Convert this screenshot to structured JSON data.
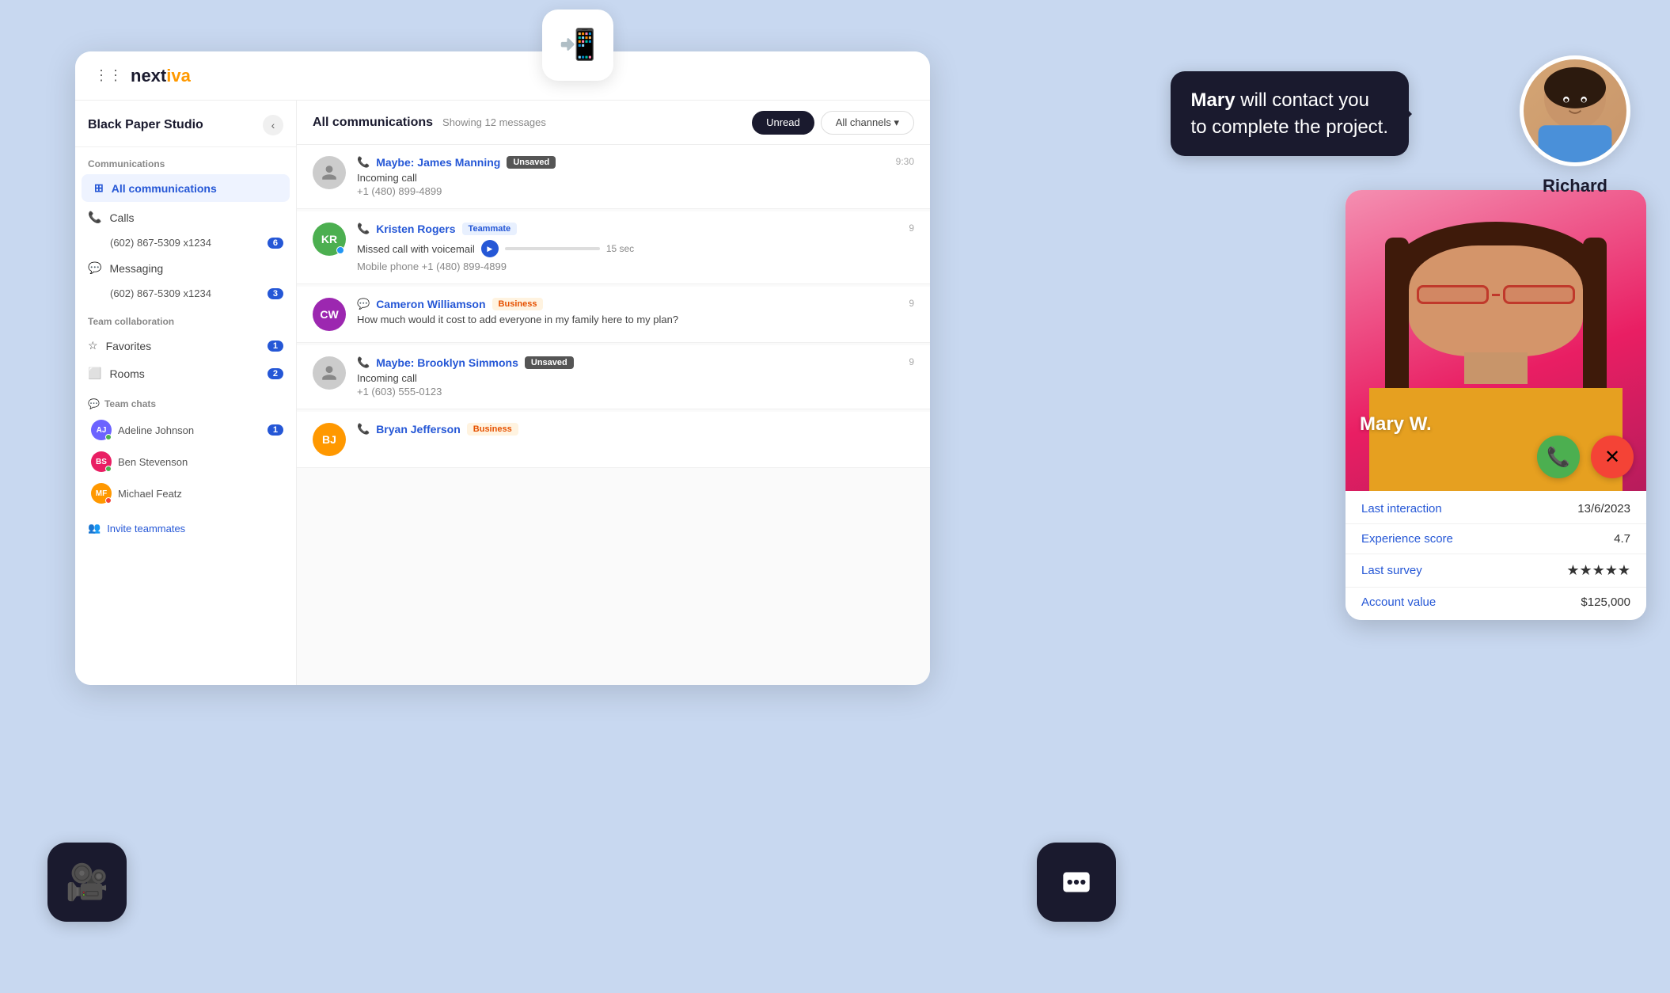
{
  "app": {
    "logo_next": "next",
    "logo_tiva": "iva",
    "workspace_name": "Black Paper Studio"
  },
  "sidebar": {
    "sections": {
      "communications": "Communications",
      "team_collaboration": "Team collaboration",
      "team_chats": "Team chats"
    },
    "nav_items": [
      {
        "id": "all-communications",
        "label": "All communications",
        "icon": "⊞",
        "active": true
      },
      {
        "id": "calls",
        "label": "Calls",
        "icon": "📞"
      },
      {
        "id": "calls-number",
        "label": "(602) 867-5309 x1234",
        "badge": "6"
      },
      {
        "id": "messaging",
        "label": "Messaging",
        "icon": "💬"
      },
      {
        "id": "messaging-number",
        "label": "(602) 867-5309 x1234",
        "badge": "3"
      }
    ],
    "team_collab": [
      {
        "id": "favorites",
        "label": "Favorites",
        "icon": "☆",
        "badge": "1"
      },
      {
        "id": "rooms",
        "label": "Rooms",
        "icon": "⬜",
        "badge": "2"
      }
    ],
    "team_chat_users": [
      {
        "id": "adeline",
        "label": "Adeline Johnson",
        "initials": "AJ",
        "color": "#6c63ff",
        "dot_color": "#4caf50",
        "badge": "1"
      },
      {
        "id": "ben",
        "label": "Ben Stevenson",
        "initials": "BS",
        "color": "#e91e63",
        "dot_color": "#4caf50"
      },
      {
        "id": "michael",
        "label": "Michael Featz",
        "initials": "MF",
        "color": "#ff9800",
        "dot_color": "#f44336"
      }
    ],
    "invite_label": "Invite teammates"
  },
  "communications": {
    "title": "All communications",
    "subtitle": "Showing 12 messages",
    "filters": {
      "unread": "Unread",
      "all_channels": "All channels ▾"
    },
    "messages": [
      {
        "id": "james-manning",
        "name": "Maybe: James Manning",
        "tag": "Unsaved",
        "tag_type": "unsaved",
        "line1": "Incoming call",
        "line2": "+1 (480) 899-4899",
        "time": "9:30",
        "avatar_initials": "",
        "avatar_color": "gray",
        "icon": "phone"
      },
      {
        "id": "kristen-rogers",
        "name": "Kristen Rogers",
        "tag": "Teammate",
        "tag_type": "teammate",
        "line1": "Missed call with voicemail",
        "line2": "Mobile phone +1 (480) 899-4899",
        "time": "9",
        "avatar_initials": "KR",
        "avatar_color": "#4caf50",
        "has_voicemail": true,
        "voicemail_duration": "15 sec",
        "icon": "phone"
      },
      {
        "id": "cameron-williamson",
        "name": "Cameron Williamson",
        "tag": "Business",
        "tag_type": "business",
        "line1": "How much would it cost to add everyone in my family here to my plan?",
        "line2": "",
        "time": "9",
        "avatar_initials": "CW",
        "avatar_color": "#9c27b0",
        "icon": "message"
      },
      {
        "id": "brooklyn-simmons",
        "name": "Maybe: Brooklyn Simmons",
        "tag": "Unsaved",
        "tag_type": "unsaved",
        "line1": "Incoming call",
        "line2": "+1 (603) 555-0123",
        "time": "9",
        "avatar_initials": "",
        "avatar_color": "gray",
        "icon": "phone"
      },
      {
        "id": "bryan-jefferson",
        "name": "Bryan Jefferson",
        "tag": "Business",
        "tag_type": "business",
        "line1": "",
        "line2": "",
        "time": "",
        "avatar_initials": "BJ",
        "avatar_color": "#ff9800",
        "icon": "phone"
      }
    ]
  },
  "tooltip": {
    "bold_text": "Mary",
    "rest_text": " will contact you\nto complete the project."
  },
  "richard": {
    "name": "Richard"
  },
  "call_card": {
    "person_name": "Mary W.",
    "info": {
      "last_interaction_label": "Last interaction",
      "last_interaction_value": "13/6/2023",
      "experience_score_label": "Experience score",
      "experience_score_value": "4.7",
      "last_survey_label": "Last survey",
      "stars": "★★★★★",
      "account_value_label": "Account value",
      "account_value_value": "$125,000"
    }
  },
  "icons": {
    "phone": "📞",
    "video": "📹",
    "chat": "💬",
    "grid": "⋮⋮",
    "chevron_left": "‹",
    "chevron_down": "▾",
    "star_empty": "☆",
    "star_filled": "★",
    "people": "👥",
    "accept_call": "📞",
    "decline_call": "✕"
  }
}
